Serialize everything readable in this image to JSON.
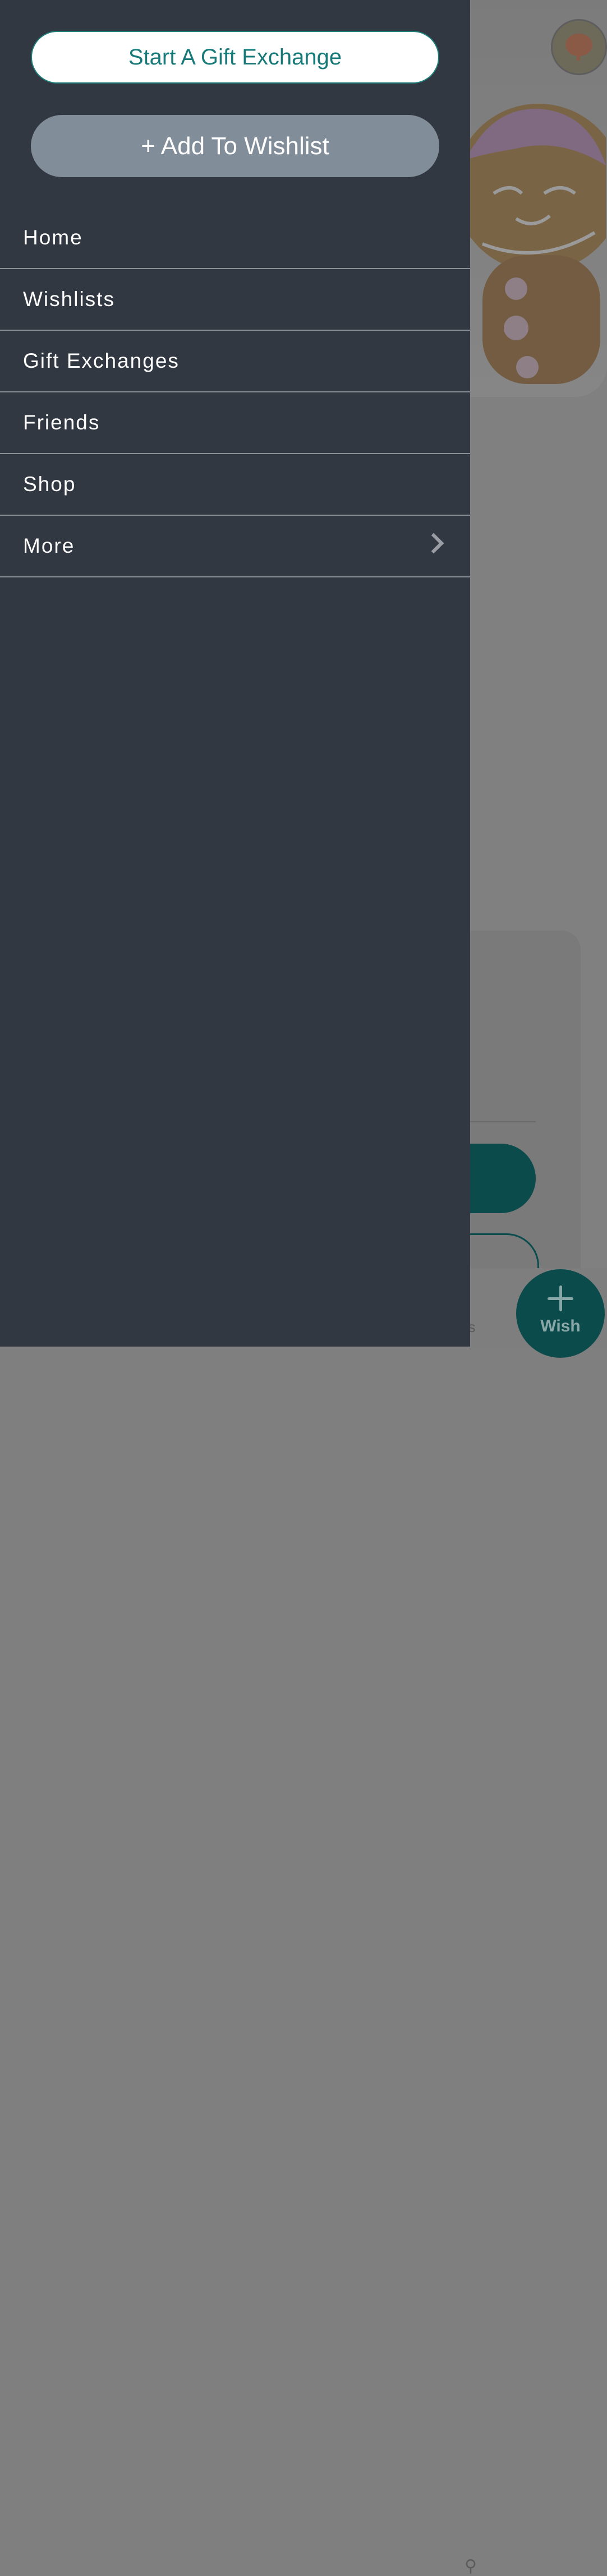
{
  "drawer": {
    "start_exchange_label": "Start A Gift Exchange",
    "add_wishlist_label": "+ Add To Wishlist",
    "menu": [
      {
        "label": "Home"
      },
      {
        "label": "Wishlists"
      },
      {
        "label": "Gift Exchanges"
      },
      {
        "label": "Friends"
      },
      {
        "label": "Shop"
      },
      {
        "label": "More",
        "has_submenu": true
      }
    ]
  },
  "background": {
    "bottom_nav_partial_label": "ds",
    "fab_label": "Wish"
  },
  "colors": {
    "drawer_bg": "#323842",
    "accent_teal": "#187a78",
    "add_button_bg": "#818d99",
    "overlay": "#808080"
  }
}
